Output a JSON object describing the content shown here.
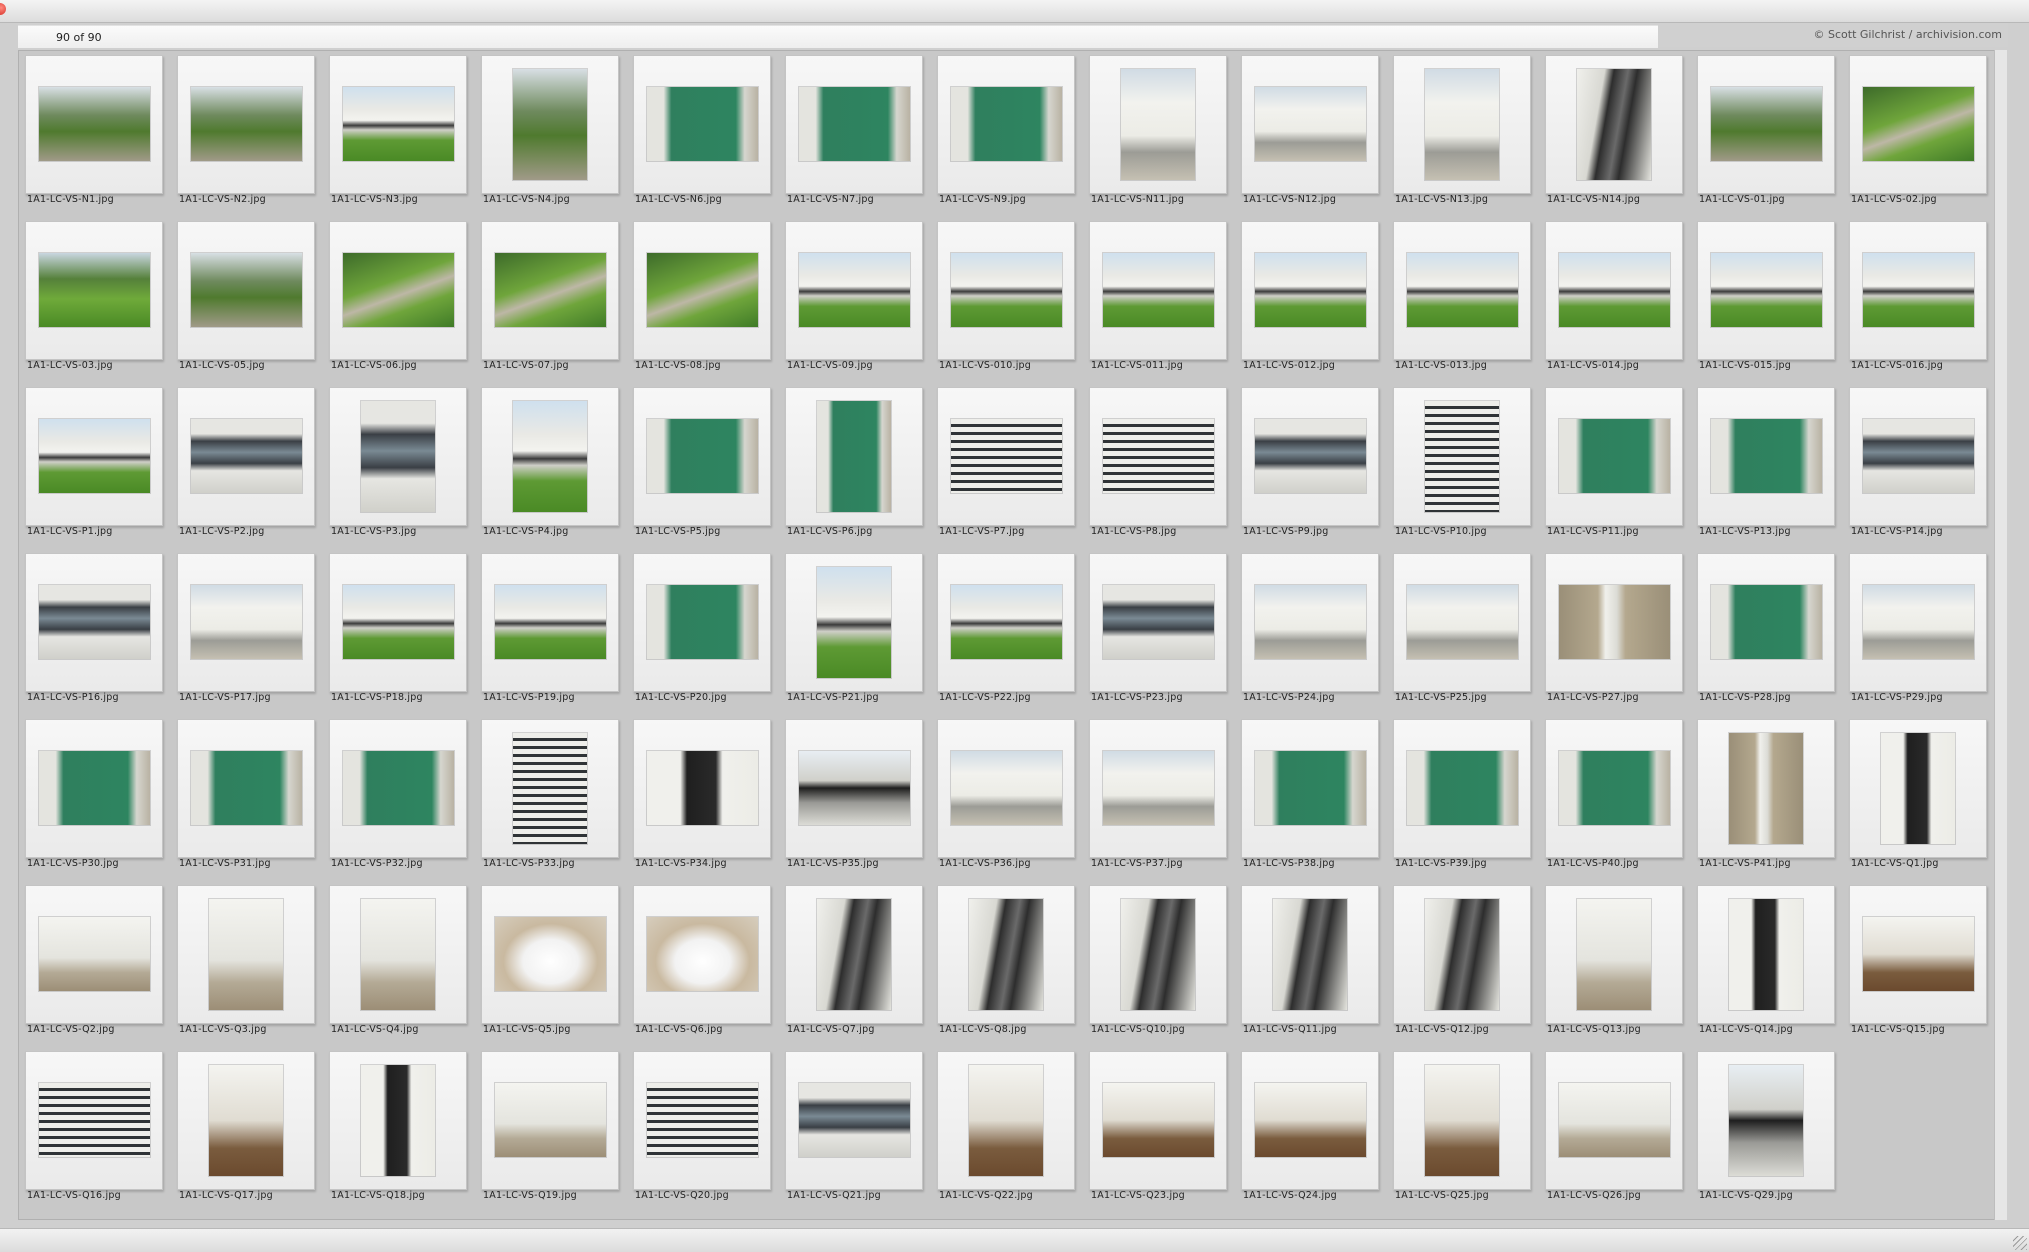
{
  "header": {
    "count": "90 of 90",
    "credit": "© Scott Gilchrist / archivision.com"
  },
  "thumbnails": [
    {
      "name": "1A1-LC-VS-N1.jpg",
      "o": "land",
      "v": "v-green"
    },
    {
      "name": "1A1-LC-VS-N2.jpg",
      "o": "land",
      "v": "v-green"
    },
    {
      "name": "1A1-LC-VS-N3.jpg",
      "o": "land",
      "v": "v-house"
    },
    {
      "name": "1A1-LC-VS-N4.jpg",
      "o": "port",
      "v": "v-green"
    },
    {
      "name": "1A1-LC-VS-N6.jpg",
      "o": "land",
      "v": "v-green-wall"
    },
    {
      "name": "1A1-LC-VS-N7.jpg",
      "o": "land",
      "v": "v-green-wall"
    },
    {
      "name": "1A1-LC-VS-N9.jpg",
      "o": "land",
      "v": "v-green-wall"
    },
    {
      "name": "1A1-LC-VS-N11.jpg",
      "o": "port",
      "v": "v-white"
    },
    {
      "name": "1A1-LC-VS-N12.jpg",
      "o": "land",
      "v": "v-white"
    },
    {
      "name": "1A1-LC-VS-N13.jpg",
      "o": "port",
      "v": "v-white"
    },
    {
      "name": "1A1-LC-VS-N14.jpg",
      "o": "port",
      "v": "v-stair"
    },
    {
      "name": "1A1-LC-VS-01.jpg",
      "o": "land",
      "v": "v-green"
    },
    {
      "name": "1A1-LC-VS-02.jpg",
      "o": "land",
      "v": "v-path"
    },
    {
      "name": "1A1-LC-VS-03.jpg",
      "o": "land",
      "v": "v-lawn"
    },
    {
      "name": "1A1-LC-VS-05.jpg",
      "o": "land",
      "v": "v-green"
    },
    {
      "name": "1A1-LC-VS-06.jpg",
      "o": "land",
      "v": "v-path"
    },
    {
      "name": "1A1-LC-VS-07.jpg",
      "o": "land",
      "v": "v-path"
    },
    {
      "name": "1A1-LC-VS-08.jpg",
      "o": "land",
      "v": "v-path"
    },
    {
      "name": "1A1-LC-VS-09.jpg",
      "o": "land",
      "v": "v-house"
    },
    {
      "name": "1A1-LC-VS-010.jpg",
      "o": "land",
      "v": "v-house"
    },
    {
      "name": "1A1-LC-VS-011.jpg",
      "o": "land",
      "v": "v-house"
    },
    {
      "name": "1A1-LC-VS-012.jpg",
      "o": "land",
      "v": "v-house"
    },
    {
      "name": "1A1-LC-VS-013.jpg",
      "o": "land",
      "v": "v-house"
    },
    {
      "name": "1A1-LC-VS-014.jpg",
      "o": "land",
      "v": "v-house"
    },
    {
      "name": "1A1-LC-VS-015.jpg",
      "o": "land",
      "v": "v-house"
    },
    {
      "name": "1A1-LC-VS-016.jpg",
      "o": "land",
      "v": "v-house"
    },
    {
      "name": "1A1-LC-VS-P1.jpg",
      "o": "land",
      "v": "v-house"
    },
    {
      "name": "1A1-LC-VS-P2.jpg",
      "o": "land",
      "v": "v-window"
    },
    {
      "name": "1A1-LC-VS-P3.jpg",
      "o": "port",
      "v": "v-window"
    },
    {
      "name": "1A1-LC-VS-P4.jpg",
      "o": "port",
      "v": "v-house"
    },
    {
      "name": "1A1-LC-VS-P5.jpg",
      "o": "land",
      "v": "v-green-wall"
    },
    {
      "name": "1A1-LC-VS-P6.jpg",
      "o": "port",
      "v": "v-green-wall"
    },
    {
      "name": "1A1-LC-VS-P7.jpg",
      "o": "land",
      "v": "v-stripe"
    },
    {
      "name": "1A1-LC-VS-P8.jpg",
      "o": "land",
      "v": "v-stripe"
    },
    {
      "name": "1A1-LC-VS-P9.jpg",
      "o": "land",
      "v": "v-window"
    },
    {
      "name": "1A1-LC-VS-P10.jpg",
      "o": "port",
      "v": "v-stripe"
    },
    {
      "name": "1A1-LC-VS-P11.jpg",
      "o": "land",
      "v": "v-green-wall"
    },
    {
      "name": "1A1-LC-VS-P13.jpg",
      "o": "land",
      "v": "v-green-wall"
    },
    {
      "name": "1A1-LC-VS-P14.jpg",
      "o": "land",
      "v": "v-window"
    },
    {
      "name": "1A1-LC-VS-P16.jpg",
      "o": "land",
      "v": "v-window"
    },
    {
      "name": "1A1-LC-VS-P17.jpg",
      "o": "land",
      "v": "v-white"
    },
    {
      "name": "1A1-LC-VS-P18.jpg",
      "o": "land",
      "v": "v-house"
    },
    {
      "name": "1A1-LC-VS-P19.jpg",
      "o": "land",
      "v": "v-house"
    },
    {
      "name": "1A1-LC-VS-P20.jpg",
      "o": "land",
      "v": "v-green-wall"
    },
    {
      "name": "1A1-LC-VS-P21.jpg",
      "o": "port",
      "v": "v-house"
    },
    {
      "name": "1A1-LC-VS-P22.jpg",
      "o": "land",
      "v": "v-house"
    },
    {
      "name": "1A1-LC-VS-P23.jpg",
      "o": "land",
      "v": "v-window"
    },
    {
      "name": "1A1-LC-VS-P24.jpg",
      "o": "land",
      "v": "v-white"
    },
    {
      "name": "1A1-LC-VS-P25.jpg",
      "o": "land",
      "v": "v-white"
    },
    {
      "name": "1A1-LC-VS-P27.jpg",
      "o": "land",
      "v": "v-column"
    },
    {
      "name": "1A1-LC-VS-P28.jpg",
      "o": "land",
      "v": "v-green-wall"
    },
    {
      "name": "1A1-LC-VS-P29.jpg",
      "o": "land",
      "v": "v-white"
    },
    {
      "name": "1A1-LC-VS-P30.jpg",
      "o": "land",
      "v": "v-green-wall"
    },
    {
      "name": "1A1-LC-VS-P31.jpg",
      "o": "land",
      "v": "v-green-wall"
    },
    {
      "name": "1A1-LC-VS-P32.jpg",
      "o": "land",
      "v": "v-green-wall"
    },
    {
      "name": "1A1-LC-VS-P33.jpg",
      "o": "port",
      "v": "v-stripe"
    },
    {
      "name": "1A1-LC-VS-P34.jpg",
      "o": "land",
      "v": "v-door"
    },
    {
      "name": "1A1-LC-VS-P35.jpg",
      "o": "land",
      "v": "v-sky"
    },
    {
      "name": "1A1-LC-VS-P36.jpg",
      "o": "land",
      "v": "v-white"
    },
    {
      "name": "1A1-LC-VS-P37.jpg",
      "o": "land",
      "v": "v-white"
    },
    {
      "name": "1A1-LC-VS-P38.jpg",
      "o": "land",
      "v": "v-green-wall"
    },
    {
      "name": "1A1-LC-VS-P39.jpg",
      "o": "land",
      "v": "v-green-wall"
    },
    {
      "name": "1A1-LC-VS-P40.jpg",
      "o": "land",
      "v": "v-green-wall"
    },
    {
      "name": "1A1-LC-VS-P41.jpg",
      "o": "port",
      "v": "v-column"
    },
    {
      "name": "1A1-LC-VS-Q1.jpg",
      "o": "port",
      "v": "v-door"
    },
    {
      "name": "1A1-LC-VS-Q2.jpg",
      "o": "land",
      "v": "v-interior"
    },
    {
      "name": "1A1-LC-VS-Q3.jpg",
      "o": "port",
      "v": "v-interior"
    },
    {
      "name": "1A1-LC-VS-Q4.jpg",
      "o": "port",
      "v": "v-interior"
    },
    {
      "name": "1A1-LC-VS-Q5.jpg",
      "o": "land",
      "v": "v-sink"
    },
    {
      "name": "1A1-LC-VS-Q6.jpg",
      "o": "land",
      "v": "v-sink"
    },
    {
      "name": "1A1-LC-VS-Q7.jpg",
      "o": "port",
      "v": "v-stair"
    },
    {
      "name": "1A1-LC-VS-Q8.jpg",
      "o": "port",
      "v": "v-stair"
    },
    {
      "name": "1A1-LC-VS-Q10.jpg",
      "o": "port",
      "v": "v-stair"
    },
    {
      "name": "1A1-LC-VS-Q11.jpg",
      "o": "port",
      "v": "v-stair"
    },
    {
      "name": "1A1-LC-VS-Q12.jpg",
      "o": "port",
      "v": "v-stair"
    },
    {
      "name": "1A1-LC-VS-Q13.jpg",
      "o": "port",
      "v": "v-interior"
    },
    {
      "name": "1A1-LC-VS-Q14.jpg",
      "o": "port",
      "v": "v-door"
    },
    {
      "name": "1A1-LC-VS-Q15.jpg",
      "o": "land",
      "v": "v-room"
    },
    {
      "name": "1A1-LC-VS-Q16.jpg",
      "o": "land",
      "v": "v-stripe"
    },
    {
      "name": "1A1-LC-VS-Q17.jpg",
      "o": "port",
      "v": "v-room"
    },
    {
      "name": "1A1-LC-VS-Q18.jpg",
      "o": "port",
      "v": "v-door"
    },
    {
      "name": "1A1-LC-VS-Q19.jpg",
      "o": "land",
      "v": "v-interior"
    },
    {
      "name": "1A1-LC-VS-Q20.jpg",
      "o": "land",
      "v": "v-stripe"
    },
    {
      "name": "1A1-LC-VS-Q21.jpg",
      "o": "land",
      "v": "v-window"
    },
    {
      "name": "1A1-LC-VS-Q22.jpg",
      "o": "port",
      "v": "v-room"
    },
    {
      "name": "1A1-LC-VS-Q23.jpg",
      "o": "land",
      "v": "v-room"
    },
    {
      "name": "1A1-LC-VS-Q24.jpg",
      "o": "land",
      "v": "v-room"
    },
    {
      "name": "1A1-LC-VS-Q25.jpg",
      "o": "port",
      "v": "v-room"
    },
    {
      "name": "1A1-LC-VS-Q26.jpg",
      "o": "land",
      "v": "v-interior"
    },
    {
      "name": "1A1-LC-VS-Q29.jpg",
      "o": "port",
      "v": "v-sky"
    }
  ]
}
